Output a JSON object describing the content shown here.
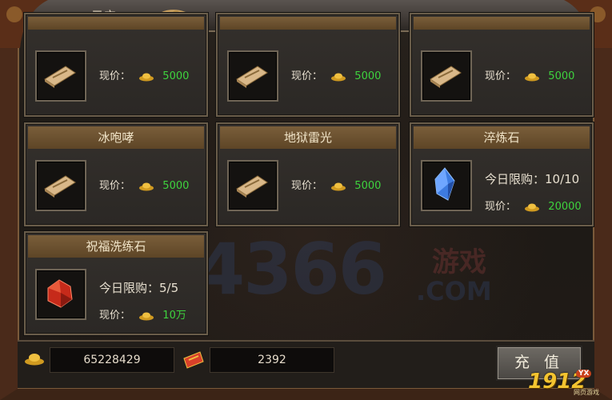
{
  "window": {
    "title": "元宝"
  },
  "cards_row1": [
    {
      "name_cut": "",
      "price_label": "现价：",
      "price": "5000"
    },
    {
      "name_cut": "",
      "price_label": "现价：",
      "price": "5000"
    },
    {
      "name_cut": "",
      "price_label": "现价：",
      "price": "5000"
    }
  ],
  "cards_row2": [
    {
      "name": "冰咆哮",
      "price_label": "现价：",
      "price": "5000",
      "icon": "skill-book-icon"
    },
    {
      "name": "地狱雷光",
      "price_label": "现价：",
      "price": "5000",
      "icon": "skill-book-icon"
    },
    {
      "name": "淬炼石",
      "limit_label": "今日限购：10/10",
      "price_label": "现价：",
      "price": "20000",
      "icon": "blue-crystal-icon"
    }
  ],
  "cards_row3": [
    {
      "name": "祝福洗练石",
      "limit_label": "今日限购：5/5",
      "price_label": "现价：",
      "price": "10万",
      "icon": "red-gem-icon"
    }
  ],
  "bottom": {
    "gold_value": "65228429",
    "ticket_value": "2392",
    "recharge_label": "充 值"
  },
  "watermark": {
    "number": "4366",
    "domain": ".COM",
    "cn": "游戏"
  },
  "logo": {
    "brand": "1912",
    "sub": "网页游戏",
    "badge": "YX"
  },
  "colors": {
    "price_green": "#3ed33e",
    "header_brown": "#7a5e3a",
    "gold": "#f0c040"
  }
}
